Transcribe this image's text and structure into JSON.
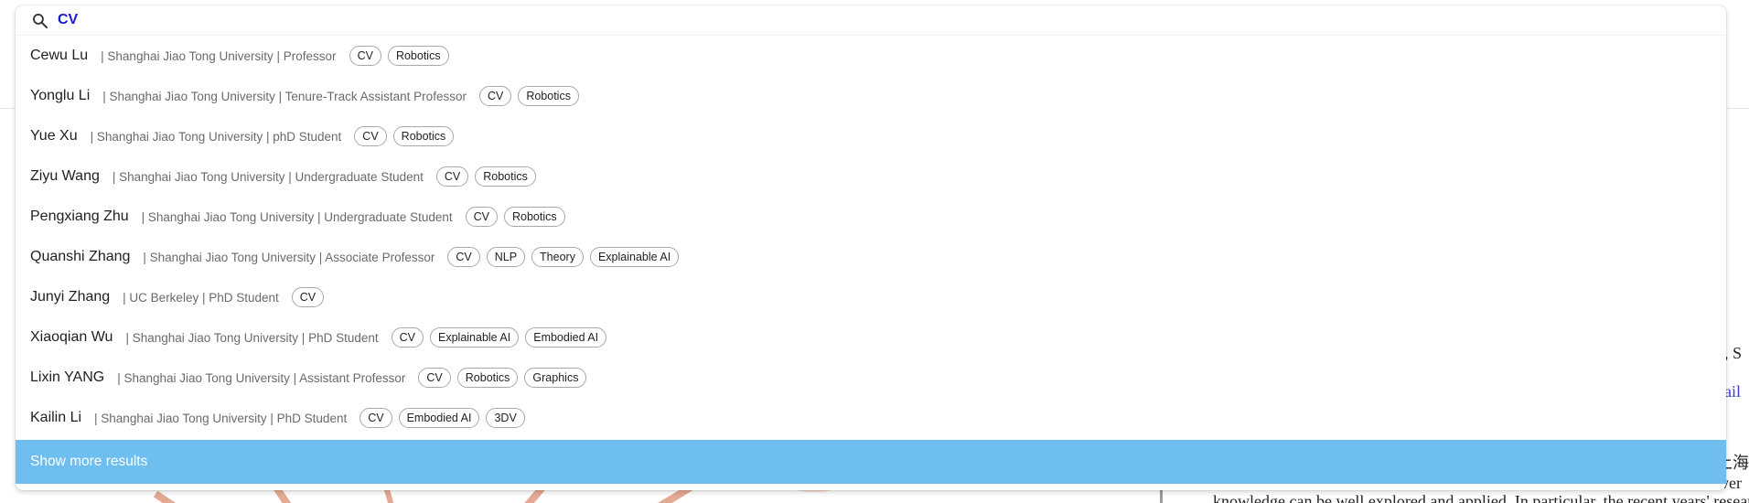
{
  "search": {
    "query": "CV"
  },
  "results": [
    {
      "name": "Cewu Lu",
      "meta": "| Shanghai Jiao Tong University | Professor",
      "tags": [
        "CV",
        "Robotics"
      ]
    },
    {
      "name": "Yonglu Li",
      "meta": "| Shanghai Jiao Tong University | Tenure-Track Assistant Professor",
      "tags": [
        "CV",
        "Robotics"
      ]
    },
    {
      "name": "Yue Xu",
      "meta": "| Shanghai Jiao Tong University | phD Student",
      "tags": [
        "CV",
        "Robotics"
      ]
    },
    {
      "name": "Ziyu Wang",
      "meta": "| Shanghai Jiao Tong University | Undergraduate Student",
      "tags": [
        "CV",
        "Robotics"
      ]
    },
    {
      "name": "Pengxiang Zhu",
      "meta": "| Shanghai Jiao Tong University | Undergraduate Student",
      "tags": [
        "CV",
        "Robotics"
      ]
    },
    {
      "name": "Quanshi Zhang",
      "meta": "| Shanghai Jiao Tong University | Associate Professor",
      "tags": [
        "CV",
        "NLP",
        "Theory",
        "Explainable AI"
      ]
    },
    {
      "name": "Junyi Zhang",
      "meta": "| UC Berkeley | PhD Student",
      "tags": [
        "CV"
      ]
    },
    {
      "name": "Xiaoqian Wu",
      "meta": "| Shanghai Jiao Tong University | PhD Student",
      "tags": [
        "CV",
        "Explainable AI",
        "Embodied AI"
      ]
    },
    {
      "name": "Lixin YANG",
      "meta": "| Shanghai Jiao Tong University | Assistant Professor",
      "tags": [
        "CV",
        "Robotics",
        "Graphics"
      ]
    },
    {
      "name": "Kailin Li",
      "meta": "| Shanghai Jiao Tong University | PhD Student",
      "tags": [
        "CV",
        "Embodied AI",
        "3DV"
      ]
    }
  ],
  "show_more_label": "Show more results",
  "background": {
    "text_1": "g, S",
    "text_2": "nail",
    "text_3": "上海",
    "text_4": "iver",
    "text_5": "knowledge can be well explored and applied. In particular, the recent years' resear"
  },
  "colors": {
    "query_text": "#1a1acd",
    "show_more_bg": "#6ebeef",
    "tag_border": "#a8a8a8"
  },
  "icons": {
    "search": "search-icon"
  }
}
